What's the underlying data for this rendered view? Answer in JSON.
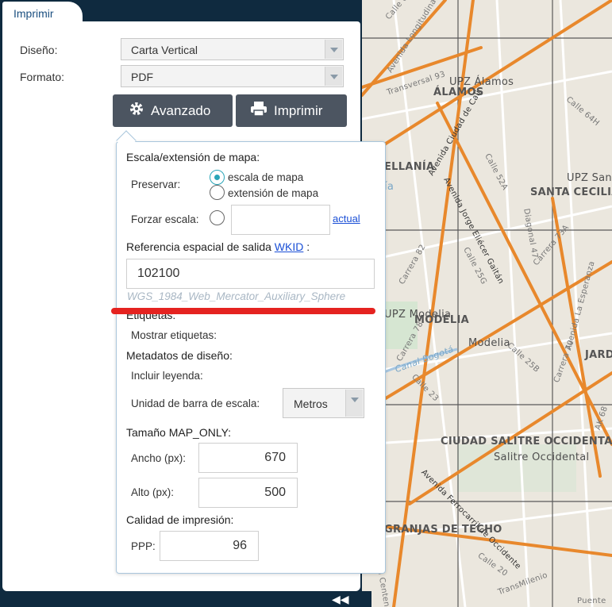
{
  "tab": {
    "label": "Imprimir"
  },
  "form": {
    "layout_label": "Diseño:",
    "layout_value": "Carta Vertical",
    "format_label": "Formato:",
    "format_value": "PDF",
    "advanced_button": "Avanzado",
    "print_button": "Imprimir"
  },
  "advanced": {
    "scale_extent_heading": "Escala/extensión de mapa:",
    "preserve_label": "Preservar:",
    "preserve_options": [
      "escala de mapa",
      "extensión de mapa"
    ],
    "preserve_selected": "escala de mapa",
    "force_scale_label": "Forzar escala:",
    "force_scale_value": "",
    "current_link": "actual",
    "spatial_ref_label": "Referencia espacial de salida",
    "wkid_link": "WKID",
    "spatial_ref_colon": ":",
    "wkid_value": "102100",
    "wkid_name": "WGS_1984_Web_Mercator_Auxiliary_Sphere",
    "labels_heading": "Etiquetas:",
    "show_labels_label": "Mostrar etiquetas:",
    "layout_metadata_heading": "Metadatos de diseño:",
    "include_legend_label": "Incluir leyenda:",
    "scalebar_unit_label": "Unidad de barra de escala:",
    "scalebar_unit_value": "Metros",
    "map_only_heading": "Tamaño MAP_ONLY:",
    "width_label": "Ancho (px):",
    "width_value": "670",
    "height_label": "Alto (px):",
    "height_value": "500",
    "quality_heading": "Calidad de impresión:",
    "dpi_label": "PPP:",
    "dpi_value": "96"
  },
  "map": {
    "labels": {
      "upz_alamos": "UPZ Álamos",
      "alamos": "ÁLAMOS",
      "ellania": "ELLANÍA",
      "santa_cecilia": "SANTA CECILIA",
      "upz_santa": "UPZ Sant",
      "modelia_upz": "UPZ Modelia",
      "modelia": "MODELIA",
      "modelia_small": "Modelia",
      "jard": "JARD",
      "ciudad_salitre": "CIUDAD SALITRE OCCIDENTAL",
      "salitre_occ": "Salitre Occidental",
      "granjas": "GRANJAS DE TECHO",
      "ia": "ía",
      "puente": "Puente",
      "calle_63": "Calle 63",
      "av_longitudinal": "Avenida Longitudinal de Occidente",
      "transversal_93": "Transversal 93",
      "calle_64h": "Calle 64H",
      "av_ciudad_cali": "Avenida Ciudad de Cali",
      "calle_52a": "Calle 52A",
      "av_jorge": "Avenida Jorge Eliécer Gaitán",
      "diagonal_47": "Diagonal 47",
      "carrera_73a": "Carrera 73A",
      "carrera_82": "Carrera 82",
      "calle_25g": "Calle 25G",
      "carrera_70": "Carrera 70",
      "carrera_78": "Carrera 78",
      "calle_25b": "Calle 25B",
      "canal_bogota": "Canal Bogotá",
      "calle_23": "Calle 23",
      "av_ferrocarril": "Avenida Ferrocarril de Occidente",
      "av_centenario": "Avenida Centenario",
      "calle_20": "Calle 20",
      "transmilenio": "TransMilenio",
      "av_esperanza": "Avenida La Esperanza",
      "ak_68": "AK 68"
    }
  }
}
